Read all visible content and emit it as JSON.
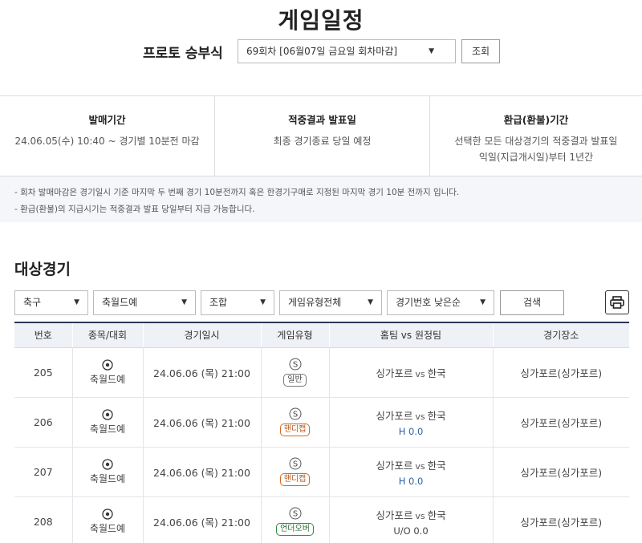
{
  "page": {
    "title": "게임일정"
  },
  "proto": {
    "label": "프로토 승부식",
    "round_selected": "69회차 [06월07일 금요일 회차마감]",
    "lookup_label": "조회"
  },
  "info": {
    "sale_period": {
      "title": "발매기간",
      "body": "24.06.05(수) 10:40 ~ 경기별 10분전 마감"
    },
    "result_announce": {
      "title": "적중결과 발표일",
      "body": "최종 경기종료 당일 예정"
    },
    "refund_period": {
      "title": "환급(환불)기간",
      "body_line1": "선택한 모든 대상경기의 적중결과 발표일",
      "body_line2": "익일(지급개시일)부터 1년간"
    }
  },
  "notices": [
    "- 회차 발매마감은 경기일시 기준 마지막 두 번째 경기 10분전까지 혹은 한경기구매로 지정된 마지막 경기 10분 전까지 입니다.",
    "- 환급(환불)의 지급시기는 적중결과 발표 당일부터 지급 가능합니다."
  ],
  "section": {
    "title": "대상경기"
  },
  "filters": {
    "sport": "축구",
    "league": "축월드예",
    "combo": "조합",
    "game_type": "게임유형전체",
    "sort": "경기번호 낮은순",
    "search_label": "검색"
  },
  "table": {
    "headers": {
      "num": "번호",
      "sport": "종목/대회",
      "datetime": "경기일시",
      "type": "게임유형",
      "teams": "홈팀 vs 원정팀",
      "venue": "경기장소"
    },
    "vs_label": "vs",
    "s_mark": "S",
    "rows": [
      {
        "num": "205",
        "sport": "축월드예",
        "datetime": "24.06.06 (목) 21:00",
        "type": "일반",
        "home": "싱가포르",
        "away": "한국",
        "handicap": "",
        "venue": "싱가포르(싱가포르)"
      },
      {
        "num": "206",
        "sport": "축월드예",
        "datetime": "24.06.06 (목) 21:00",
        "type": "핸디캡",
        "home": "싱가포르",
        "away": "한국",
        "handicap": "H 0.0",
        "venue": "싱가포르(싱가포르)"
      },
      {
        "num": "207",
        "sport": "축월드예",
        "datetime": "24.06.06 (목) 21:00",
        "type": "핸디캡",
        "home": "싱가포르",
        "away": "한국",
        "handicap": "H 0.0",
        "venue": "싱가포르(싱가포르)"
      },
      {
        "num": "208",
        "sport": "축월드예",
        "datetime": "24.06.06 (목) 21:00",
        "type": "언더오버",
        "home": "싱가포르",
        "away": "한국",
        "handicap": "U/O 0.0",
        "venue": "싱가포르(싱가포르)"
      }
    ]
  },
  "colors": {
    "header_border": "#2b3a55",
    "header_bg": "#eef1f6",
    "handicap_accent": "#d2691e",
    "overunder_accent": "#2e8b3e",
    "handicap_value": "#2a5ea8"
  },
  "icons": {
    "ball": "soccer-ball-icon",
    "print": "printer-icon",
    "caret": "caret-down-icon",
    "s_badge": "s-circle-icon"
  }
}
